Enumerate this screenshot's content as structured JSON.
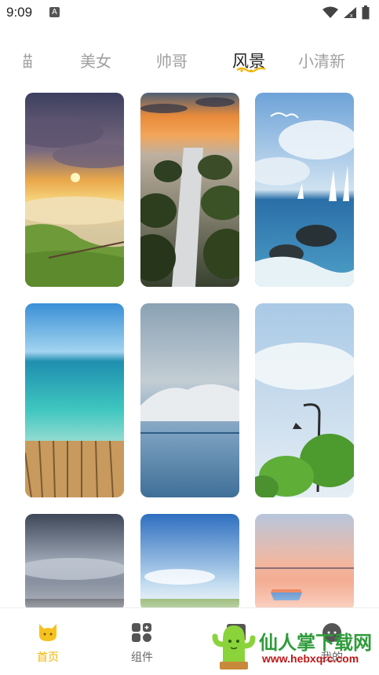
{
  "status_bar": {
    "time": "9:09",
    "notification_icon": "A"
  },
  "tabs": {
    "items": [
      {
        "label": "猫"
      },
      {
        "label": "美女"
      },
      {
        "label": "帅哥"
      },
      {
        "label": "风景",
        "active": true
      },
      {
        "label": "小清新"
      }
    ]
  },
  "wallpapers": [
    {
      "name": "sunset-clouds-hill"
    },
    {
      "name": "rocks-waterfall-sunset"
    },
    {
      "name": "sea-sailboats-gulls"
    },
    {
      "name": "tropical-sea-pier"
    },
    {
      "name": "calm-sea-mountains"
    },
    {
      "name": "street-lamp-tree"
    },
    {
      "name": "dusk-sky-landscape"
    },
    {
      "name": "blue-sky-field"
    },
    {
      "name": "pink-sunset-boat"
    }
  ],
  "bottom_nav": {
    "items": [
      {
        "label": "首页",
        "icon": "cat-face-icon",
        "active": true
      },
      {
        "label": "组件",
        "icon": "widgets-icon"
      },
      {
        "label": "",
        "icon": "download-icon"
      },
      {
        "label": "我的",
        "icon": "more-icon"
      }
    ]
  },
  "watermark": {
    "title": "仙人掌下载网",
    "url": "www.hebxqrc.com"
  },
  "colors": {
    "accent": "#f0b400",
    "active_tab": "#222222",
    "inactive_tab": "#a0a0a0"
  }
}
